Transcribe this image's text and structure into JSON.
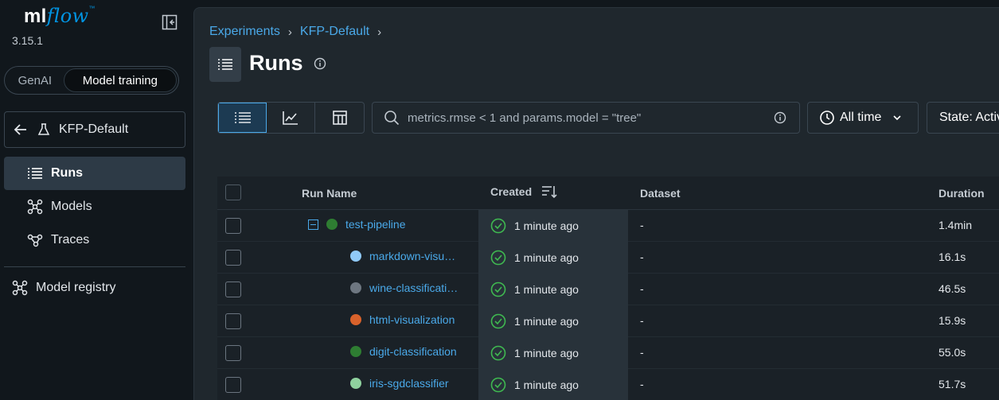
{
  "app": {
    "logo_ml": "ml",
    "logo_flow": "flow",
    "logo_tm": "™",
    "version": "3.15.1"
  },
  "mode_toggle": {
    "options": [
      "GenAI",
      "Model training"
    ],
    "selected": "Model training"
  },
  "sidebar": {
    "experiment_name": "KFP-Default",
    "items": [
      {
        "label": "Runs",
        "icon": "list-icon",
        "active": true
      },
      {
        "label": "Models",
        "icon": "models-icon",
        "active": false
      },
      {
        "label": "Traces",
        "icon": "traces-icon",
        "active": false
      }
    ],
    "registry_label": "Model registry"
  },
  "breadcrumb": [
    "Experiments",
    "KFP-Default"
  ],
  "page": {
    "title": "Runs"
  },
  "toolbar": {
    "search_placeholder": "metrics.rmse < 1 and params.model = \"tree\"",
    "time_filter": "All time",
    "state_filter": "State: Active"
  },
  "table": {
    "columns": [
      "Run Name",
      "Created",
      "Dataset",
      "Duration"
    ],
    "rows": [
      {
        "name": "test-pipeline",
        "color": "#2e7d32",
        "parent": true,
        "created": "1 minute ago",
        "dataset": "-",
        "duration": "1.4min"
      },
      {
        "name": "markdown-visu…",
        "color": "#90caf9",
        "parent": false,
        "created": "1 minute ago",
        "dataset": "-",
        "duration": "16.1s"
      },
      {
        "name": "wine-classificati…",
        "color": "#6e7781",
        "parent": false,
        "created": "1 minute ago",
        "dataset": "-",
        "duration": "46.5s"
      },
      {
        "name": "html-visualization",
        "color": "#d9622b",
        "parent": false,
        "created": "1 minute ago",
        "dataset": "-",
        "duration": "15.9s"
      },
      {
        "name": "digit-classification",
        "color": "#2e7d32",
        "parent": false,
        "created": "1 minute ago",
        "dataset": "-",
        "duration": "55.0s"
      },
      {
        "name": "iris-sgdclassifier",
        "color": "#8fd19e",
        "parent": false,
        "created": "1 minute ago",
        "dataset": "-",
        "duration": "51.7s"
      }
    ]
  },
  "colors": {
    "accent": "#4aa9e9",
    "success": "#3fb950"
  }
}
